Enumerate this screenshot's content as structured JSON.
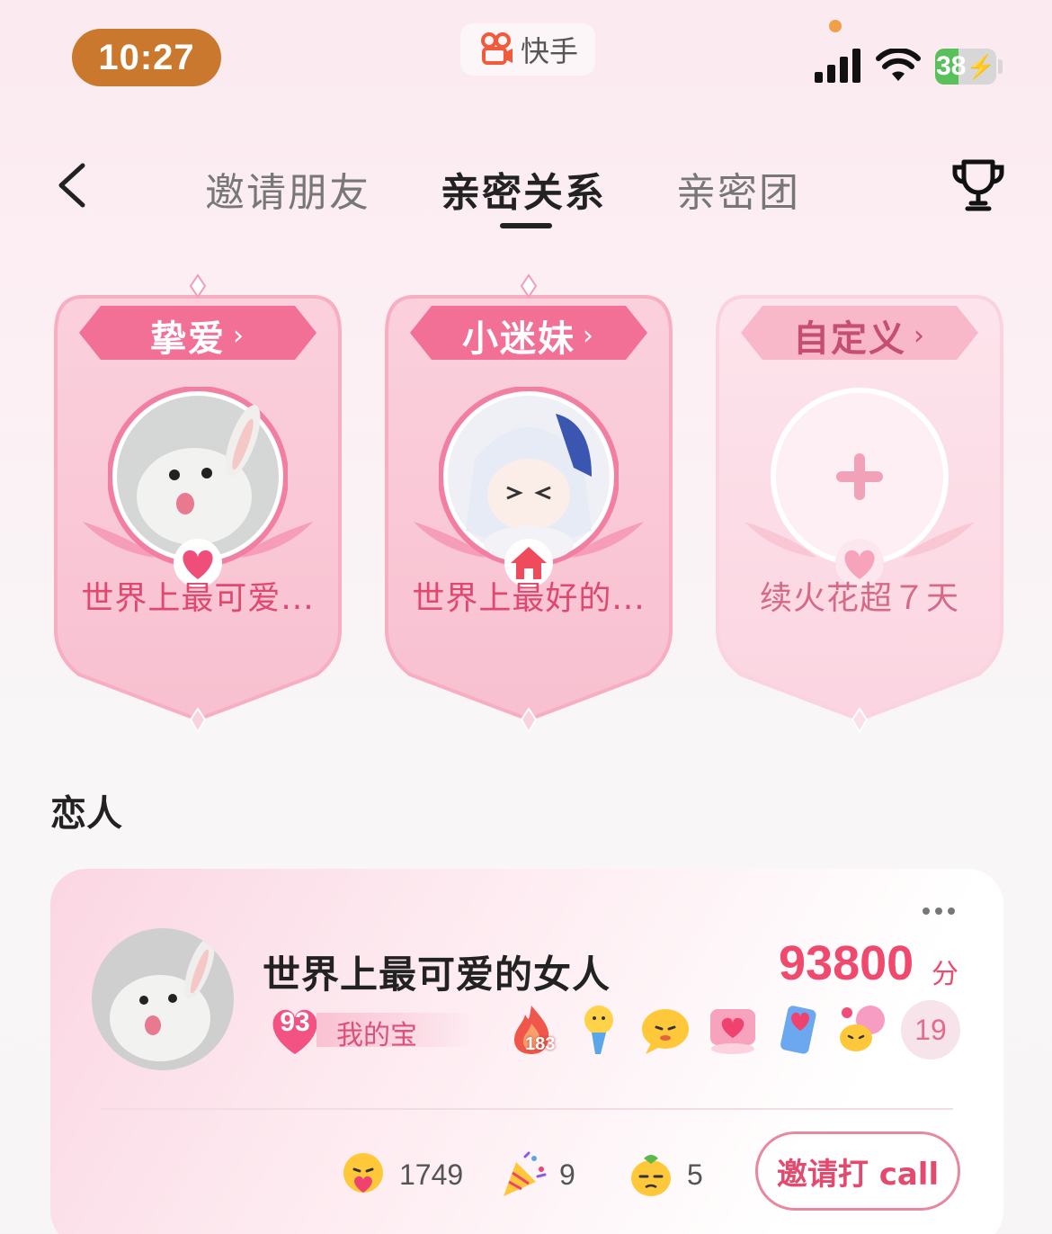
{
  "status_bar": {
    "time": "10:27",
    "app_name": "快手",
    "battery": "38",
    "battery_level": 0.38
  },
  "nav": {
    "tabs": [
      {
        "label": "邀请朋友",
        "active": false
      },
      {
        "label": "亲密关系",
        "active": true
      },
      {
        "label": "亲密团",
        "active": false
      }
    ],
    "back_icon": "chevron-left-icon",
    "trophy_icon": "trophy-icon"
  },
  "cards": [
    {
      "tag": "挚爱",
      "chevron": "›",
      "label": "世界上最可爱...",
      "avatar": "bunny-avatar",
      "badge_icon": "heart-icon"
    },
    {
      "tag": "小迷妹",
      "chevron": "›",
      "label": "世界上最好的...",
      "avatar": "anime-girl-avatar",
      "badge_icon": "house-icon"
    },
    {
      "tag": "自定义",
      "chevron": "›",
      "label": "续火花超７天",
      "avatar": "plus-icon",
      "badge_icon": "heart-icon"
    }
  ],
  "section": {
    "title": "恋人"
  },
  "relation": {
    "name": "世界上最可爱的女人",
    "score": "93800",
    "score_unit": "分",
    "level": "93",
    "level_label": "我的宝",
    "emoji_small_count": "183",
    "extra_count": "19",
    "stats": [
      {
        "icon": "hug-emoji-icon",
        "value": "1749"
      },
      {
        "icon": "party-popper-icon",
        "value": "9"
      },
      {
        "icon": "lemon-face-icon",
        "value": "5"
      }
    ],
    "call_button": "邀请打 call",
    "colors": {
      "accent": "#ef4a6d",
      "pink_light": "#fbd6e2"
    }
  }
}
